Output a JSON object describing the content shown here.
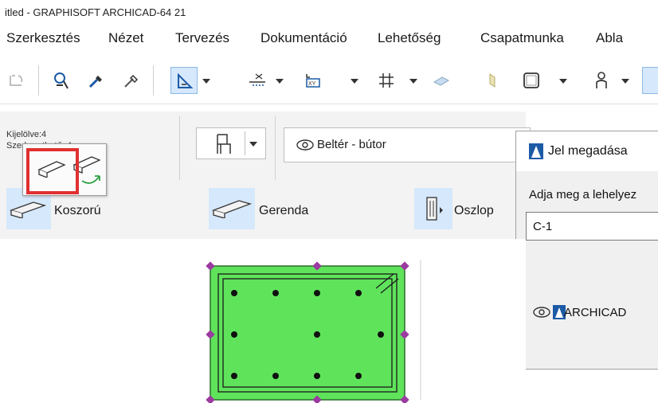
{
  "window": {
    "title": "itled - GRAPHISOFT ARCHICAD-64 21"
  },
  "menu": {
    "items": [
      "Szerkesztés",
      "Nézet",
      "Tervezés",
      "Dokumentáció",
      "Lehetőség",
      "Csapatmunka",
      "Abla"
    ]
  },
  "toolbar": {
    "icons": [
      "redo-icon",
      "pick-up-icon",
      "eyedropper-icon",
      "inject-icon",
      "snap-guide-icon",
      "guideline-icon",
      "coordinates-icon",
      "grid-icon",
      "plane-icon",
      "cut-plane-icon",
      "view-icon",
      "human-icon"
    ]
  },
  "info_box": {
    "selected": "Kijelölve:4",
    "editable": "Szerkeszthető: 4",
    "layer_name": "Beltér - bútor"
  },
  "tools": {
    "koszoru": "Koszorú",
    "gerenda": "Gerenda",
    "oszlop": "Oszlop"
  },
  "dialog": {
    "title": "Jel megadása",
    "prompt": "Adja meg a lehelyez",
    "input_value": "C-1",
    "layer_label": "ARCHICAD"
  },
  "colors": {
    "column_fill": "#5fe35b",
    "column_outline": "#2a6b2a",
    "node": "#9b3aa0",
    "highlight": "#e03030",
    "selection_bg": "#d6e8fb"
  }
}
